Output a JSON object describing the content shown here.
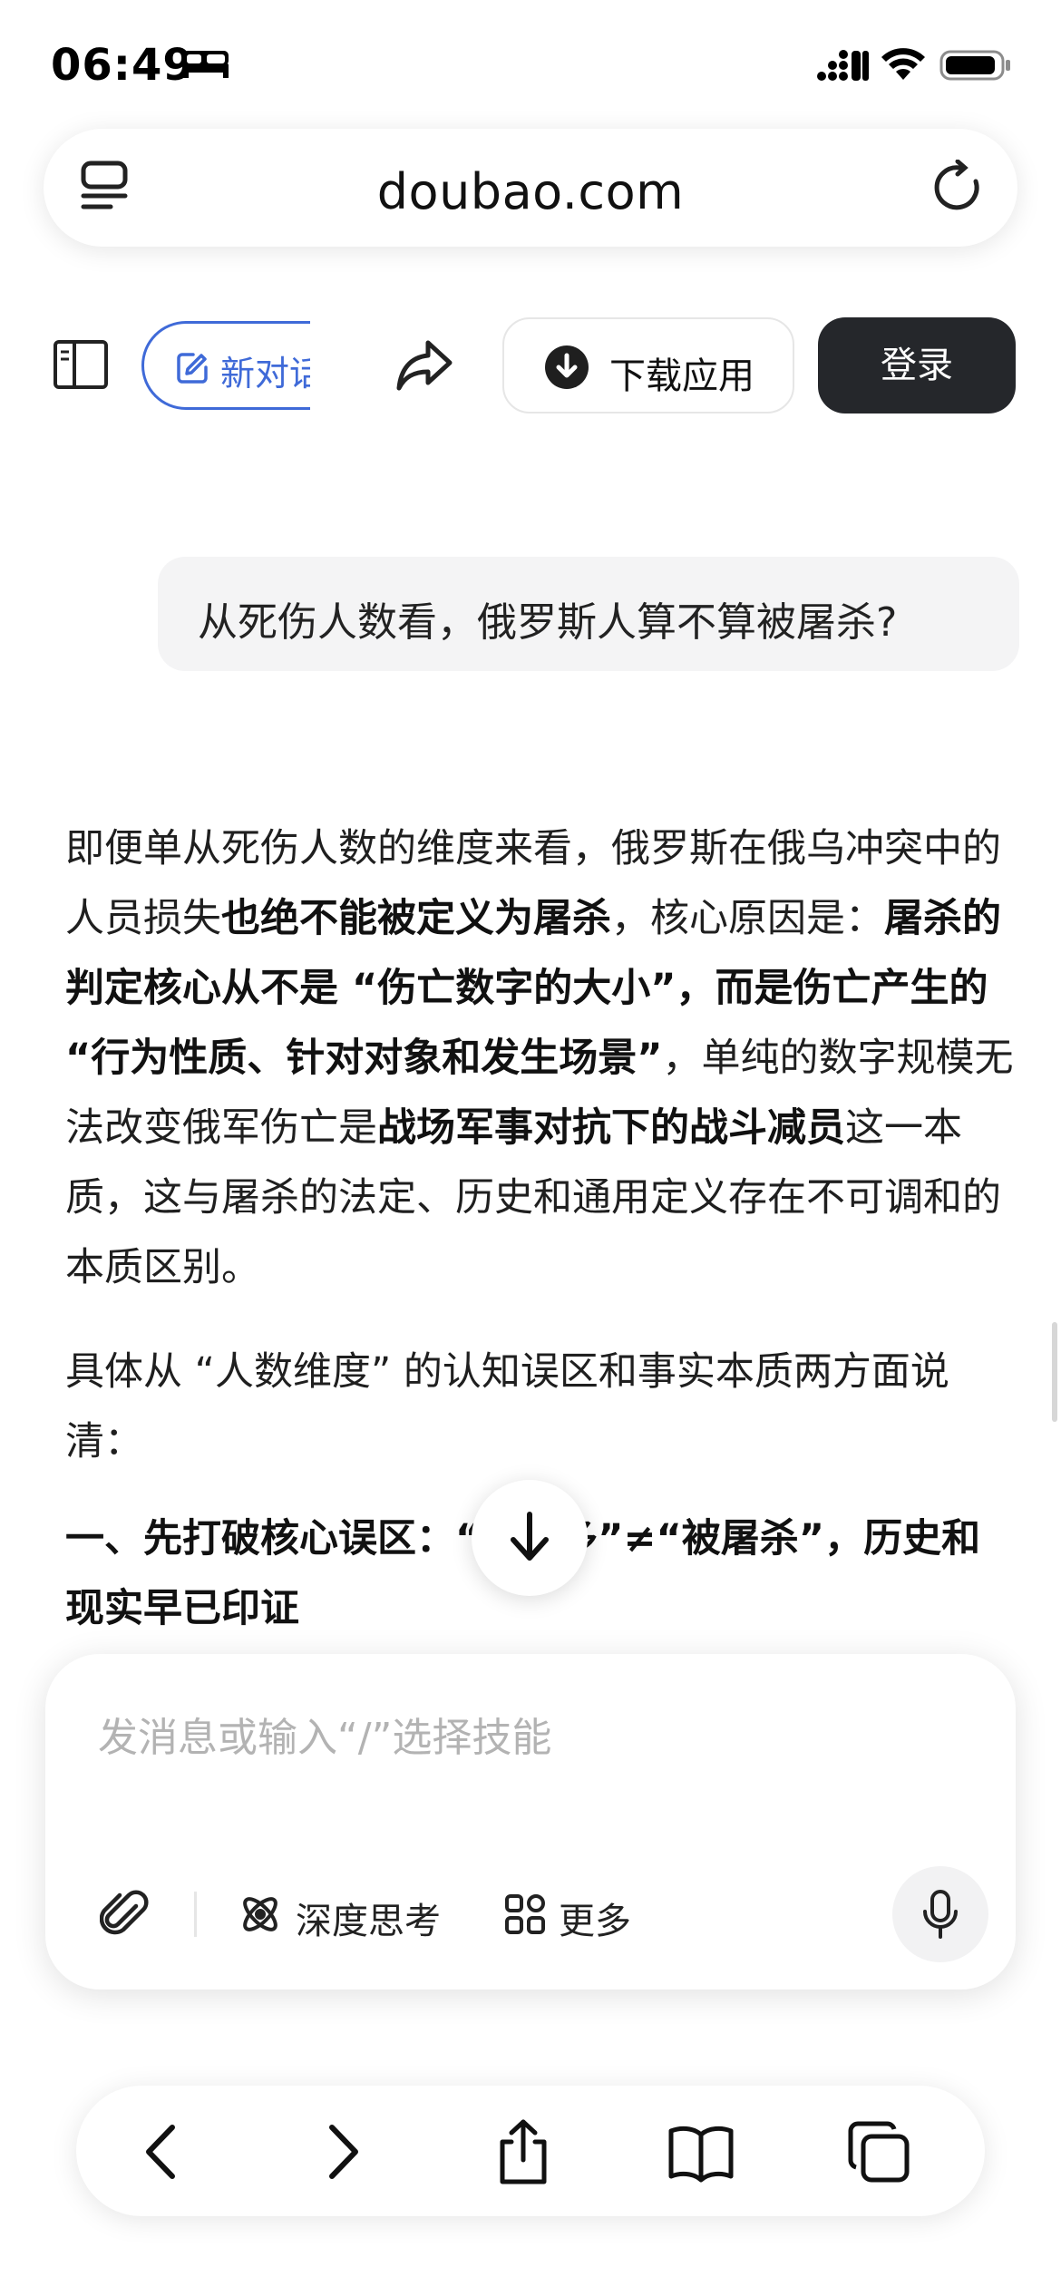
{
  "status_bar": {
    "time": "06:49",
    "icons": [
      "bed-icon",
      "signal-icon",
      "wifi-icon",
      "battery-icon"
    ]
  },
  "address_bar": {
    "url": "doubao.com",
    "icons": [
      "tabs-icon",
      "reload-icon"
    ]
  },
  "toolbar": {
    "new_chat_label": "新对话",
    "download_label": "下载应用",
    "login_label": "登录",
    "icons": [
      "sidebar-toggle-icon",
      "edit-icon",
      "share-icon",
      "download-icon"
    ]
  },
  "conversation": {
    "user_message": "从死伤人数看，俄罗斯人算不算被屠杀?",
    "answer": {
      "p1": [
        {
          "t": "即便单从死伤人数的维度来看，俄罗斯在俄乌冲突中的人员损失",
          "b": false
        },
        {
          "t": "也绝不能被定义为屠杀",
          "b": true
        },
        {
          "t": "，核心原因是：",
          "b": false
        },
        {
          "t": "屠杀的判定核心从不是 “伤亡数字的大小”，而是伤亡产生的 “行为性质、针对对象和发生场景”",
          "b": true
        },
        {
          "t": "，单纯的数字规模无法改变俄军伤亡是",
          "b": false
        },
        {
          "t": "战场军事对抗下的战斗减员",
          "b": true
        },
        {
          "t": "这一本质，这与屠杀的法定、历史和通用定义存在不可调和的本质区别。",
          "b": false
        }
      ],
      "p2": "具体从 “人数维度” 的认知误区和事实本质两方面说清：",
      "heading": "一、先打破核心误区：“伤亡多”≠“被屠杀”，历史和现实早已印证"
    }
  },
  "composer": {
    "placeholder": "发消息或输入“/”选择技能",
    "deep_think_label": "深度思考",
    "more_label": "更多",
    "icons": [
      "attach-icon",
      "deep-think-icon",
      "more-grid-icon",
      "mic-icon"
    ]
  },
  "bottom_nav": {
    "icons": [
      "back-icon",
      "forward-icon",
      "share-icon",
      "bookmarks-icon",
      "tabs-icon"
    ]
  },
  "colors": {
    "accent": "#3f6ad8",
    "login_bg": "#25272b",
    "bubble_bg": "#f4f4f5"
  }
}
